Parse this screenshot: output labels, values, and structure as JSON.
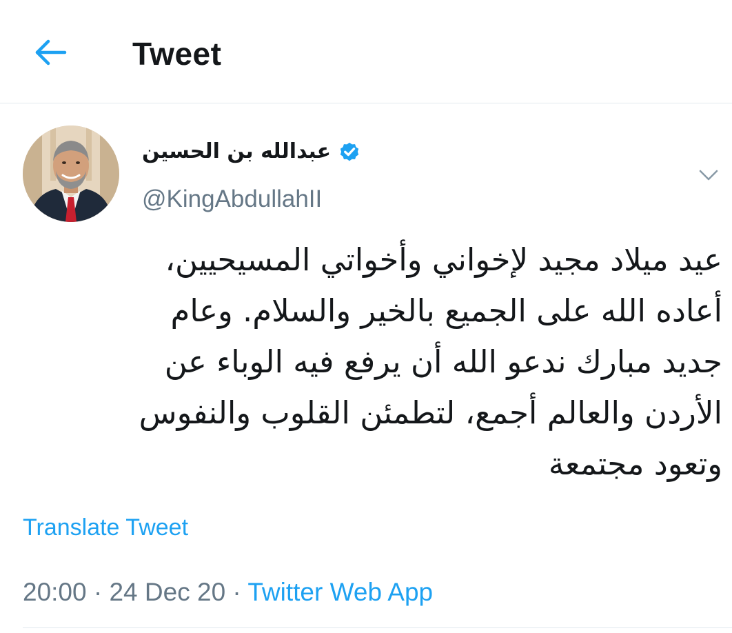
{
  "header": {
    "title": "Tweet",
    "back_icon": "arrow-left-icon"
  },
  "colors": {
    "accent": "#1da1f2",
    "text_primary": "#14171a",
    "text_secondary": "#657786",
    "divider": "#e1e8ed"
  },
  "tweet": {
    "author": {
      "display_name": "عبدالله بن الحسين",
      "handle": "@KingAbdullahII",
      "verified_icon": "verified-badge-icon",
      "avatar_icon": "profile-photo"
    },
    "caret_icon": "chevron-down-icon",
    "text_lines": [
      "عيد ميلاد مجيد لإخواني وأخواتي المسيحيين،",
      "أعاده الله على الجميع بالخير والسلام. وعام",
      "جديد مبارك ندعو الله أن يرفع فيه الوباء عن",
      "الأردن والعالم أجمع، لتطمئن القلوب والنفوس",
      "وتعود مجتمعة"
    ],
    "translate_label": "Translate Tweet",
    "time": "20:00",
    "separator": " · ",
    "date": "24 Dec 20",
    "source": "Twitter Web App"
  }
}
